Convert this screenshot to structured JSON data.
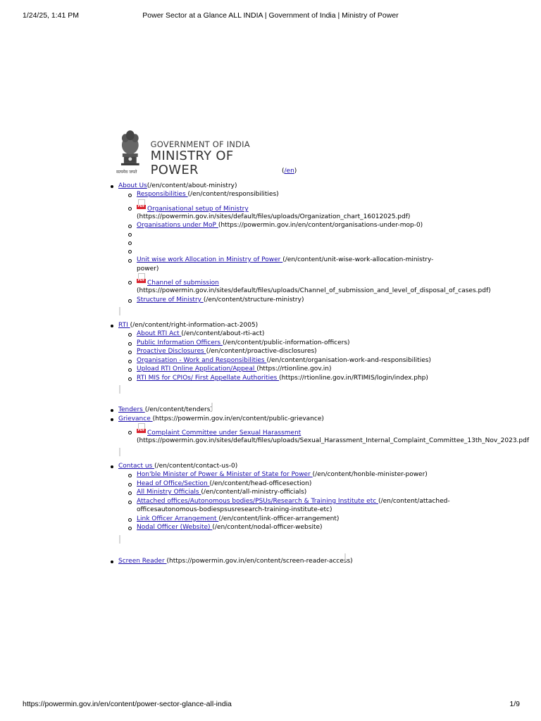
{
  "print_header": {
    "date": "1/24/25, 1:41 PM",
    "title": "Power Sector at a Glance ALL INDIA | Government of India | Ministry of Power"
  },
  "print_footer": {
    "url": "https://powermin.gov.in/en/content/power-sector-glance-all-india",
    "page": "1/9"
  },
  "logo": {
    "line1": "GOVERNMENT OF INDIA",
    "line2": "MINISTRY OF POWER",
    "caption": "सत्यमेव जयते",
    "icon": "national-emblem-icon"
  },
  "home": {
    "link": "/en"
  },
  "menu": {
    "about": {
      "label": "About Us",
      "url": "(/en/content/about-ministry)",
      "items": [
        {
          "label": "Responsibilities ",
          "url": "(/en/content/responsibilities)"
        },
        {
          "label": "Organisational setup of Ministry",
          "url": "(https://powermin.gov.in/sites/default/files/uploads/Organization_chart_16012025.pdf)",
          "pdf": true
        },
        {
          "label": "Organisations under MoP ",
          "url": "(https://powermin.gov.in/en/content/organisations-under-mop-0)"
        },
        {
          "label": "Unit wise work Allocation in Ministry of Power ",
          "url_line1": "(/en/content/unit-wise-work-allocation-ministry-",
          "url_line2": "power)"
        },
        {
          "label": "Channel of submission",
          "url": "(https://powermin.gov.in/sites/default/files/uploads/Channel_of_submission_and_level_of_disposal_of_cases.pdf)",
          "pdf": true
        },
        {
          "label": "Structure of Ministry ",
          "url": "(/en/content/structure-ministry)"
        }
      ]
    },
    "rti": {
      "label": "RTI ",
      "url": "(/en/content/right-information-act-2005)",
      "items": [
        {
          "label": "About RTI Act ",
          "url": "(/en/content/about-rti-act)"
        },
        {
          "label": "Public Information Officers ",
          "url": "(/en/content/public-information-officers)"
        },
        {
          "label": "Proactive Disclosures ",
          "url": "(/en/content/proactive-disclosures)"
        },
        {
          "label": "Organisation - Work and Responsibilities ",
          "url": "(/en/content/organisation-work-and-responsibilities)"
        },
        {
          "label": "Upload RTI Online Application/Appeal ",
          "url": "(https://rtionline.gov.in)"
        },
        {
          "label": "RTI MIS for CPIOs/ First Appellate Authorities ",
          "url": "(https://rtionline.gov.in/RTIMIS/login/index.php)"
        }
      ]
    },
    "tenders": {
      "label": "Tenders ",
      "url": "(/en/content/tenders)"
    },
    "grievance": {
      "label": "Grievance ",
      "url": "(https://powermin.gov.in/en/content/public-grievance)",
      "items": [
        {
          "label": "Complaint Committee under Sexual Harassment",
          "url": "(https://powermin.gov.in/sites/default/files/uploads/Sexual_Harassment_Internal_Complaint_Committee_13th_Nov_2023.pdf",
          "pdf": true
        }
      ]
    },
    "contact": {
      "label": "Contact us ",
      "url": "(/en/content/contact-us-0)",
      "items": [
        {
          "label": "Hon'ble Minister of Power & Minister of State for Power ",
          "url": "(/en/content/honble-minister-power)"
        },
        {
          "label": "Head of Office/Section ",
          "url": "(/en/content/head-officesection)"
        },
        {
          "label": "All Ministry Officials ",
          "url": "(/en/content/all-ministry-officials)"
        },
        {
          "label": "Attached offices/Autonomous bodies/PSUs/Research & Training Institute etc ",
          "url_line1": "(/en/content/attached-",
          "url_line2": "officesautonomous-bodiespsusresearch-training-institute-etc)"
        },
        {
          "label": "Link Officer Arrangement ",
          "url": "(/en/content/link-officer-arrangement)"
        },
        {
          "label": "Nodal Officer (Website) ",
          "url": "(/en/content/nodal-officer-website)"
        }
      ]
    },
    "screen_reader": {
      "label": "Screen Reader ",
      "url": "(https://powermin.gov.in/en/content/screen-reader-access)"
    }
  },
  "colors": {
    "link": "#1a0dab",
    "pdf_badge": "#d9232e"
  }
}
